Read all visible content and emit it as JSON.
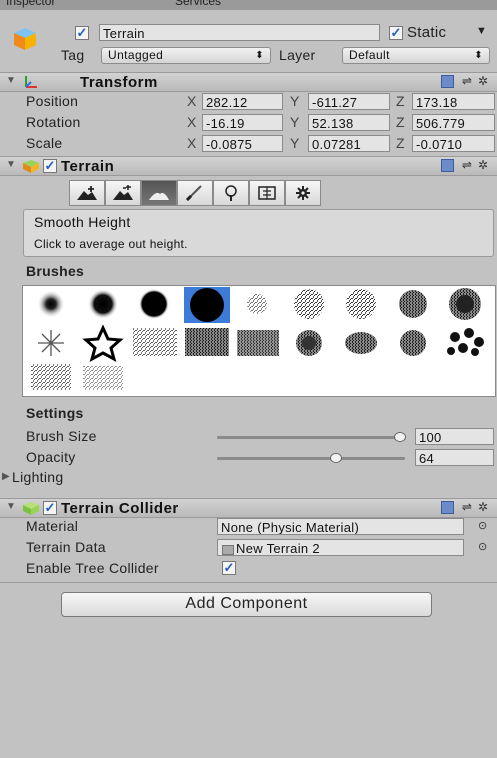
{
  "window": {
    "tab_inspector": "Inspector",
    "tab_services": "Services"
  },
  "object": {
    "active": true,
    "name": "Terrain",
    "static_label": "Static",
    "static_checked": true,
    "tag_label": "Tag",
    "tag_value": "Untagged",
    "layer_label": "Layer",
    "layer_value": "Default"
  },
  "transform": {
    "title": "Transform",
    "position": {
      "label": "Position",
      "x": "282.12",
      "y": "-611.27",
      "z": "173.18"
    },
    "rotation": {
      "label": "Rotation",
      "x": "-16.19",
      "y": "52.138",
      "z": "506.779"
    },
    "scale": {
      "label": "Scale",
      "x": "-0.0875",
      "y": "0.07281",
      "z": "-0.0710"
    },
    "axis_x": "X",
    "axis_y": "Y",
    "axis_z": "Z"
  },
  "terrain": {
    "title": "Terrain",
    "enabled": true,
    "tools": [
      "raise-lower-terrain",
      "paint-height",
      "smooth-height",
      "paint-texture",
      "place-trees",
      "paint-details",
      "terrain-settings"
    ],
    "active_tool": "smooth-height",
    "help_title": "Smooth Height",
    "help_text": "Click to average out height.",
    "brushes_label": "Brushes",
    "selected_brush_index": 3,
    "settings_label": "Settings",
    "brush_size": {
      "label": "Brush Size",
      "value": "100",
      "fraction": 1.0
    },
    "opacity": {
      "label": "Opacity",
      "value": "64",
      "fraction": 0.64
    },
    "lighting_label": "Lighting"
  },
  "terrain_collider": {
    "title": "Terrain Collider",
    "enabled": true,
    "material_label": "Material",
    "material_value": "None (Physic Material)",
    "terrain_data_label": "Terrain Data",
    "terrain_data_value": "New Terrain 2",
    "enable_tree_label": "Enable Tree Collider",
    "enable_tree_checked": true
  },
  "add_component_label": "Add Component",
  "colors": {
    "panel_bg": "#c2c2c2",
    "selection_blue": "#3d7bd9",
    "check_blue": "#1f5fbf"
  }
}
